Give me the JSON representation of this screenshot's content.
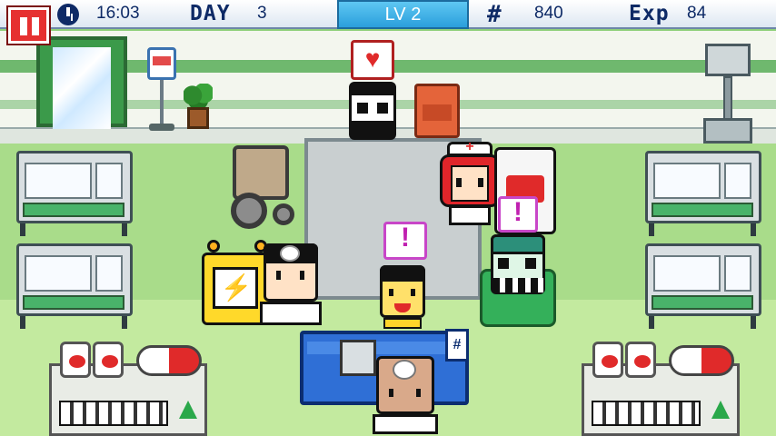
{
  "hud": {
    "time": "16:03",
    "day_label": "DAY",
    "day_value": "3",
    "level": "LV 2",
    "money_value": "840",
    "exp_label": "Exp",
    "exp_value": "84"
  },
  "icons": {
    "pause": "pause-icon",
    "clock": "clock-icon",
    "money": "money-hash-icon",
    "heart": "heart-icon",
    "alert": "exclamation-icon",
    "lightning": "lightning-icon"
  },
  "bubbles": {
    "alert_symbol": "!",
    "heart_symbol": "♥",
    "lightning_symbol": "⚡",
    "cross_symbol": "+",
    "hash_symbol": "#"
  },
  "colors": {
    "hud_text": "#0e2a66",
    "level_box": "#2b9fdc",
    "pause_button": "#e63030",
    "wall_stripe": "#6fb86e",
    "floor": "#a9dc8a",
    "alert_bubble": "#c846c8"
  }
}
